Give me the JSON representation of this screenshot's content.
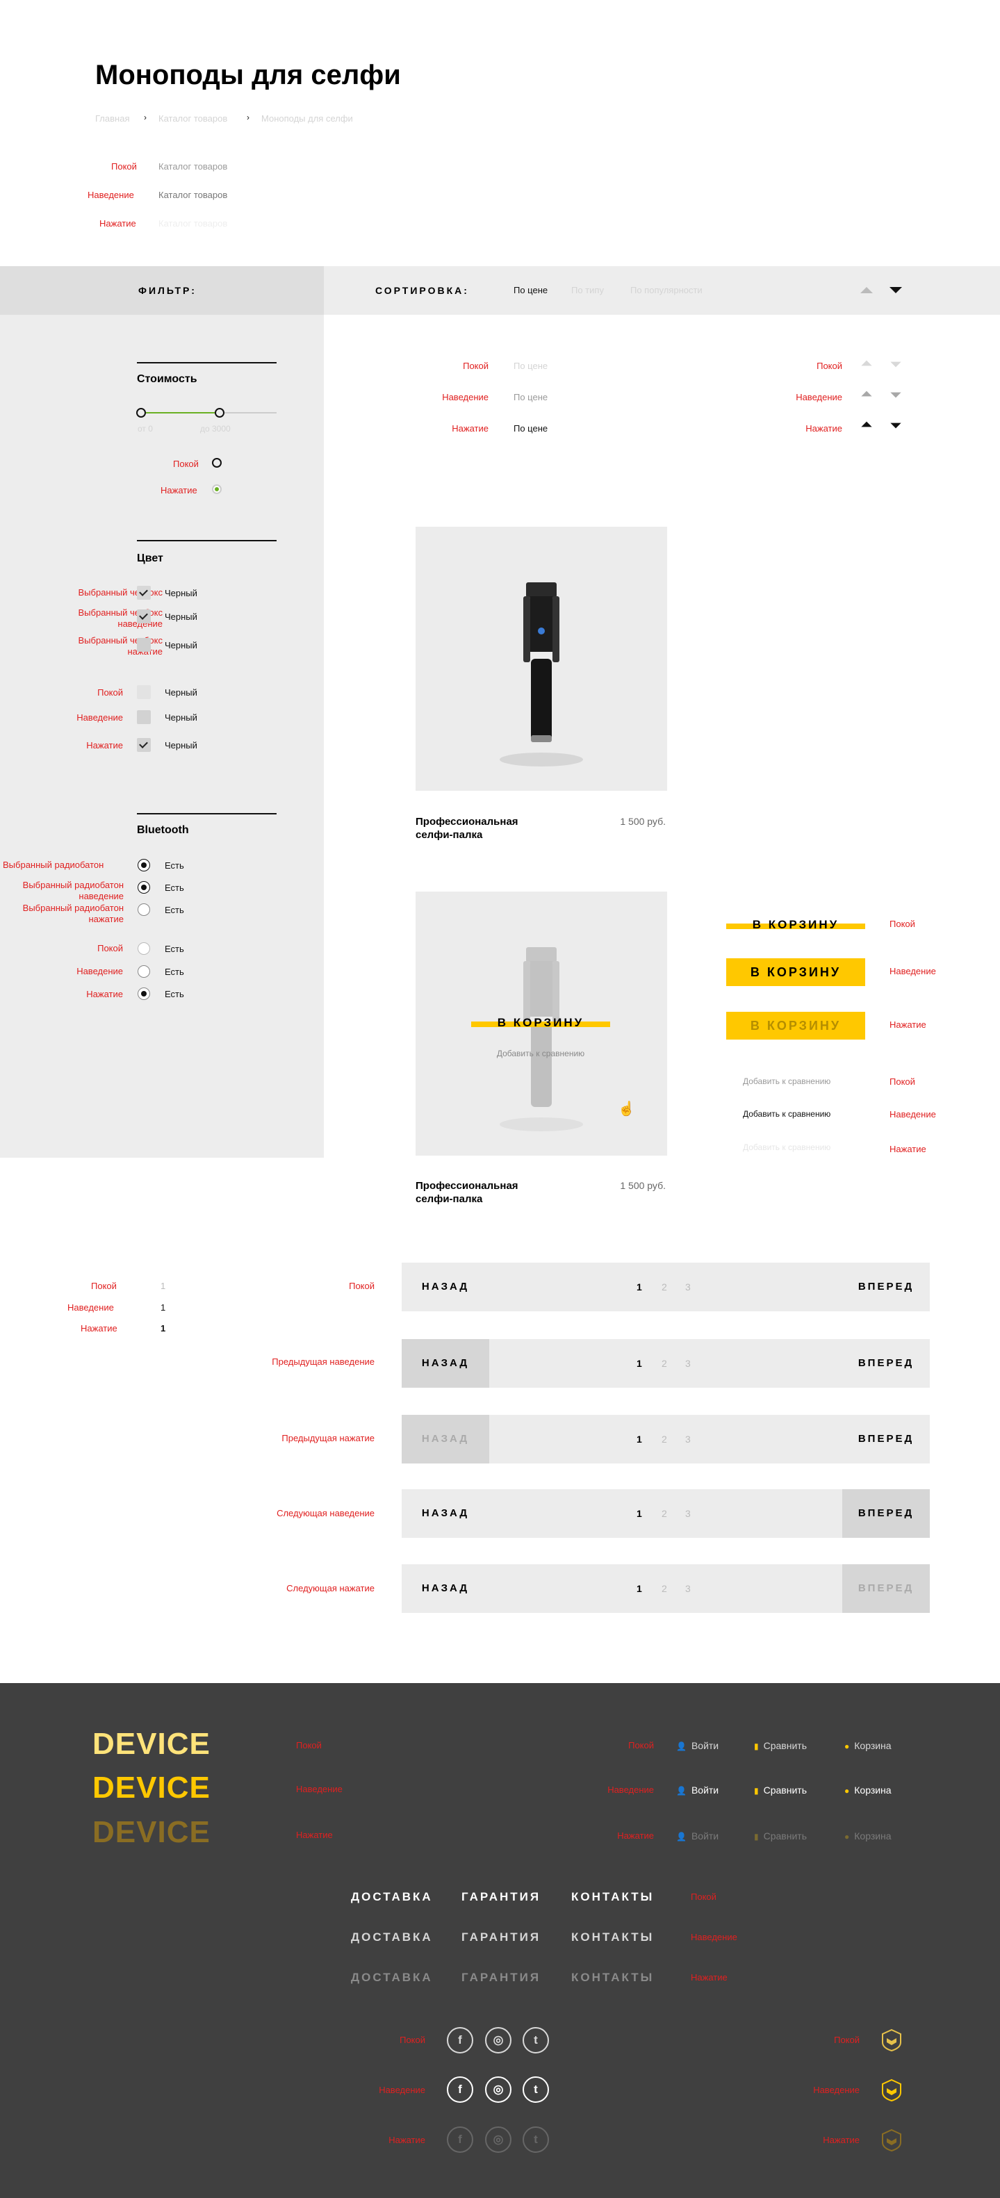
{
  "title": "Моноподы для селфи",
  "breadcrumb": [
    "Главная",
    "Каталог товаров",
    "Моноподы для селфи"
  ],
  "states": {
    "rest": "Покой",
    "hover": "Наведение",
    "press": "Нажатие"
  },
  "breadcrumb_demo": "Каталог товаров",
  "filter_label": "ФИЛЬТР:",
  "sort": {
    "label": "СОРТИРОВКА:",
    "options": [
      "По цене",
      "По типу",
      "По популярности"
    ],
    "demo": "По цене"
  },
  "price": {
    "title": "Стоимость",
    "from": "от 0",
    "to": "до 3000"
  },
  "color": {
    "title": "Цвет",
    "value": "Черный",
    "rows": [
      "Выбранный чекбокс",
      "Выбранный чекбокс наведение",
      "Выбранный чекбокс нажатие"
    ]
  },
  "bluetooth": {
    "title": "Bluetooth",
    "value": "Есть",
    "rows": [
      "Выбранный радиобатон",
      "Выбранный радиобатон наведение",
      "Выбранный радиобатон нажатие"
    ]
  },
  "products": [
    {
      "name": "Профессиональная селфи-палка",
      "price": "1 500 руб."
    },
    {
      "name": "Профессиональная селфи-палка",
      "price": "1 500 руб."
    }
  ],
  "cart_button": "В КОРЗИНУ",
  "compare_link": "Добавить к сравнению",
  "pagination": {
    "back": "НАЗАД",
    "forward": "ВПЕРЕД",
    "pages": [
      "1",
      "2",
      "3"
    ],
    "demo_page": "1",
    "labels": {
      "prev_hover": "Предыдущая наведение",
      "prev_press": "Предыдущая нажатие",
      "next_hover": "Следующая наведение",
      "next_press": "Следующая нажатие"
    }
  },
  "footer": {
    "logo": "DEVICE",
    "login": "Войти",
    "compare": "Сравнить",
    "cart": "Корзина",
    "nav": [
      "ДОСТАВКА",
      "ГАРАНТИЯ",
      "КОНТАКТЫ"
    ],
    "social_icons": [
      "facebook-icon",
      "instagram-icon",
      "twitter-icon"
    ]
  },
  "colors": {
    "accent": "#ffc800",
    "state_label": "#e02020",
    "footer_bg": "#404040",
    "sidebar_bg": "#ededed"
  }
}
